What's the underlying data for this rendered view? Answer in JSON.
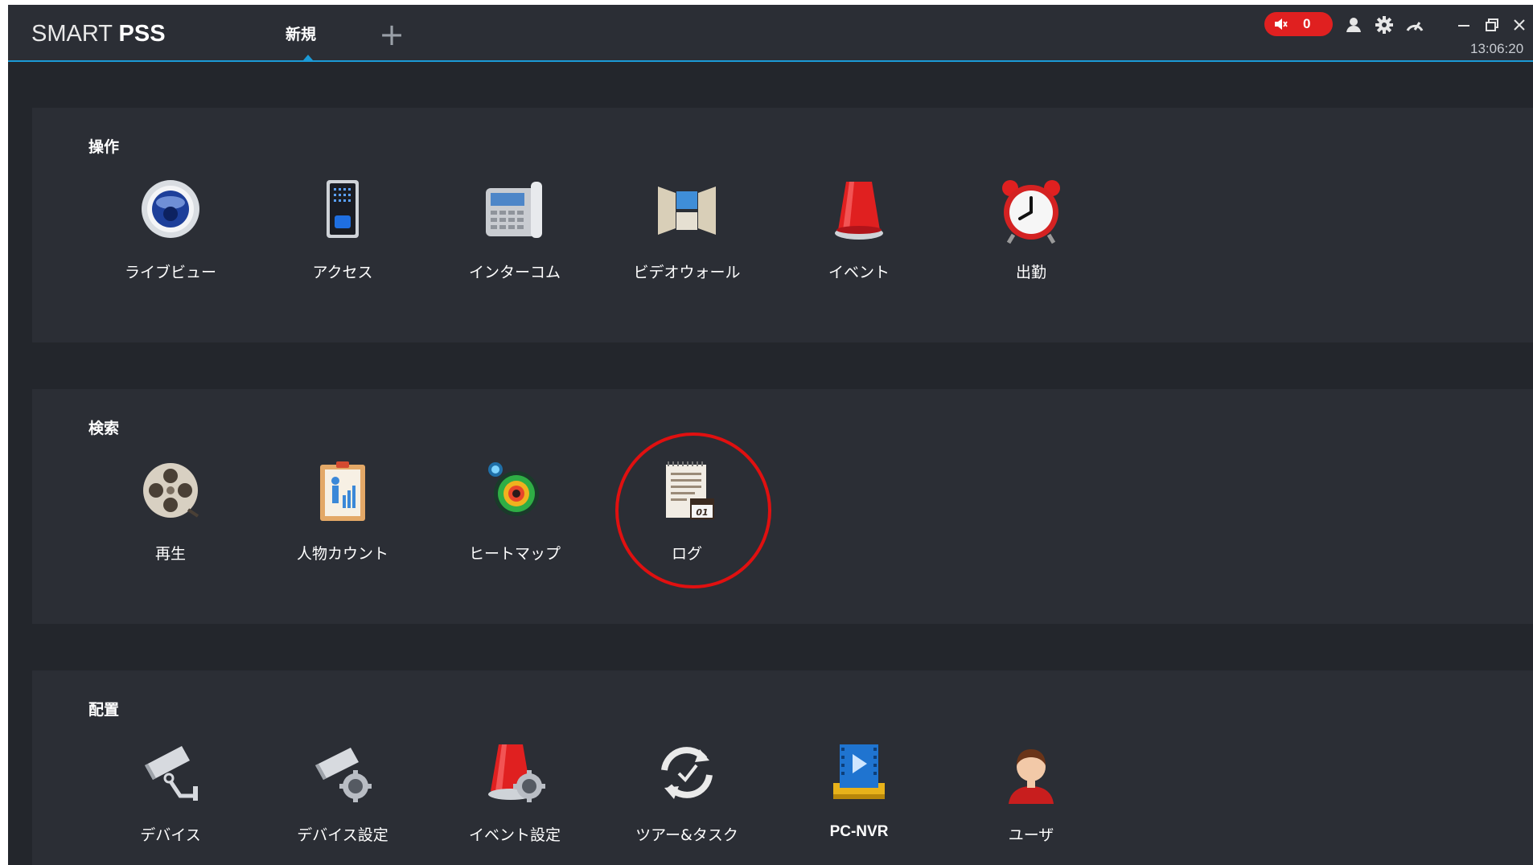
{
  "app": {
    "logo_light": "SMART ",
    "logo_bold": "PSS"
  },
  "tabs": [
    {
      "label": "新規"
    }
  ],
  "add_tab_label": "+",
  "header": {
    "alarm_count": "0",
    "time": "13:06:20"
  },
  "sections": [
    {
      "title": "操作",
      "items": [
        {
          "label": "ライブビュー",
          "icon": "live-view-icon"
        },
        {
          "label": "アクセス",
          "icon": "access-icon"
        },
        {
          "label": "インターコム",
          "icon": "intercom-icon"
        },
        {
          "label": "ビデオウォール",
          "icon": "video-wall-icon"
        },
        {
          "label": "イベント",
          "icon": "event-icon"
        },
        {
          "label": "出勤",
          "icon": "attendance-icon"
        }
      ]
    },
    {
      "title": "検索",
      "items": [
        {
          "label": "再生",
          "icon": "playback-icon"
        },
        {
          "label": "人物カウント",
          "icon": "people-counting-icon"
        },
        {
          "label": "ヒートマップ",
          "icon": "heat-map-icon"
        },
        {
          "label": "ログ",
          "icon": "log-icon"
        }
      ]
    },
    {
      "title": "配置",
      "items": [
        {
          "label": "デバイス",
          "icon": "device-icon"
        },
        {
          "label": "デバイス設定",
          "icon": "device-config-icon"
        },
        {
          "label": "イベント設定",
          "icon": "event-config-icon"
        },
        {
          "label": "ツアー&タスク",
          "icon": "tour-task-icon"
        },
        {
          "label": "PC-NVR",
          "icon": "pc-nvr-icon"
        },
        {
          "label": "ユーザ",
          "icon": "user-icon"
        }
      ]
    }
  ],
  "colors": {
    "accent": "#1b9ad6",
    "alarm": "#e02020",
    "highlight": "#e01010",
    "background": "#23262c",
    "panel": "#2b2e35"
  }
}
